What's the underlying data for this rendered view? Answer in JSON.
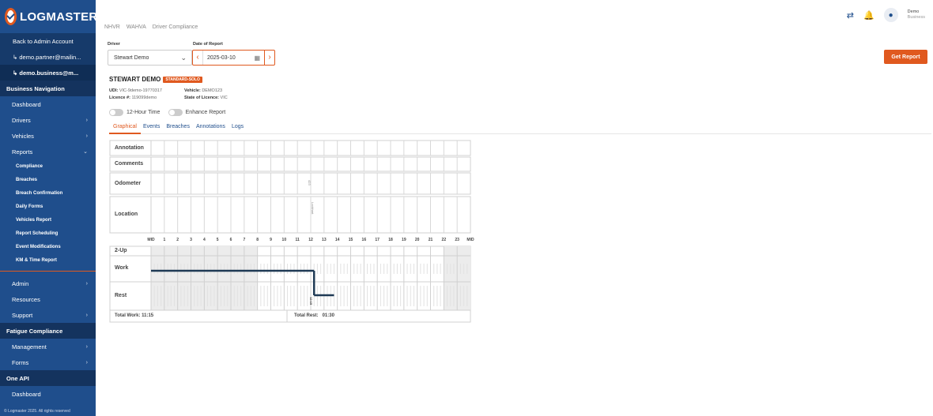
{
  "brand": {
    "name": "LOGMASTER"
  },
  "sidebar": {
    "account_items": [
      {
        "label": "Back to Admin Account"
      },
      {
        "label": "↳ demo.partner@mailin..."
      },
      {
        "label": "↳ demo.business@m..."
      }
    ],
    "business_nav_header": "Business Navigation",
    "business_items": [
      {
        "label": "Dashboard",
        "has_children": false
      },
      {
        "label": "Drivers",
        "has_children": true
      },
      {
        "label": "Vehicles",
        "has_children": true
      },
      {
        "label": "Reports",
        "has_children": true,
        "expanded": true
      }
    ],
    "report_items": [
      "Compliance",
      "Breaches",
      "Breach Confirmation",
      "Daily Forms",
      "Vehicles Report",
      "Report Scheduling",
      "Event Modifications",
      "KM & Time Report"
    ],
    "admin_items": [
      {
        "label": "Admin",
        "has_children": true
      },
      {
        "label": "Resources",
        "has_children": false
      },
      {
        "label": "Support",
        "has_children": true
      }
    ],
    "fatigue_header": "Fatigue Compliance",
    "fatigue_items": [
      {
        "label": "Management",
        "has_children": true
      },
      {
        "label": "Forms",
        "has_children": true
      }
    ],
    "api_header": "One API",
    "api_items": [
      {
        "label": "Dashboard"
      }
    ],
    "footer": "© Logmaster 2025. All rights reserved"
  },
  "topbar": {
    "tabs": [
      "NHVR",
      "WAHVA",
      "Driver Compliance"
    ],
    "user": {
      "name": "Demo",
      "role": "Business"
    },
    "icons": [
      "swap-icon",
      "bell-icon",
      "user-icon"
    ]
  },
  "filters": {
    "driver_label": "Driver",
    "driver_value": "Stewart Demo",
    "date_label": "Date of Report",
    "date_value": "2025-03-10",
    "get_report": "Get Report"
  },
  "driver": {
    "name": "STEWART DEMO",
    "badge": "STANDARD-SOLO",
    "udi_label": "UDI:",
    "udi": "VIC-9demo-19770317",
    "licence_label": "Licence #:",
    "licence": "119099demo",
    "vehicle_label": "Vehicle:",
    "vehicle": "DEMO123",
    "state_label": "State of Licence:",
    "state": "VIC"
  },
  "toggles": {
    "hour12": "12-Hour Time",
    "enhance": "Enhance Report"
  },
  "report_tabs": [
    "Graphical",
    "Events",
    "Breaches",
    "Annotations",
    "Logs"
  ],
  "grid": {
    "rows": [
      "Annotation",
      "Comments",
      "Odometer",
      "Location"
    ],
    "hours": [
      "MID",
      "1",
      "2",
      "3",
      "4",
      "5",
      "6",
      "7",
      "8",
      "9",
      "10",
      "11",
      "12",
      "13",
      "14",
      "15",
      "16",
      "17",
      "18",
      "19",
      "20",
      "21",
      "22",
      "23",
      "MID"
    ],
    "status_rows": [
      "2-Up",
      "Work",
      "Rest"
    ],
    "odometer_mark": "423",
    "location_mark": "Lockhart",
    "rest_marker": "12:15",
    "work_end_hour": 12.25,
    "rest_end_hour": 13.75,
    "total_work_label": "Total Work:",
    "total_work": "11:15",
    "total_rest_label": "Total Rest:",
    "total_rest": "01:30"
  },
  "colors": {
    "brand": "#1f4e8c",
    "accent": "#e0591f",
    "line": "#1f3a55"
  }
}
